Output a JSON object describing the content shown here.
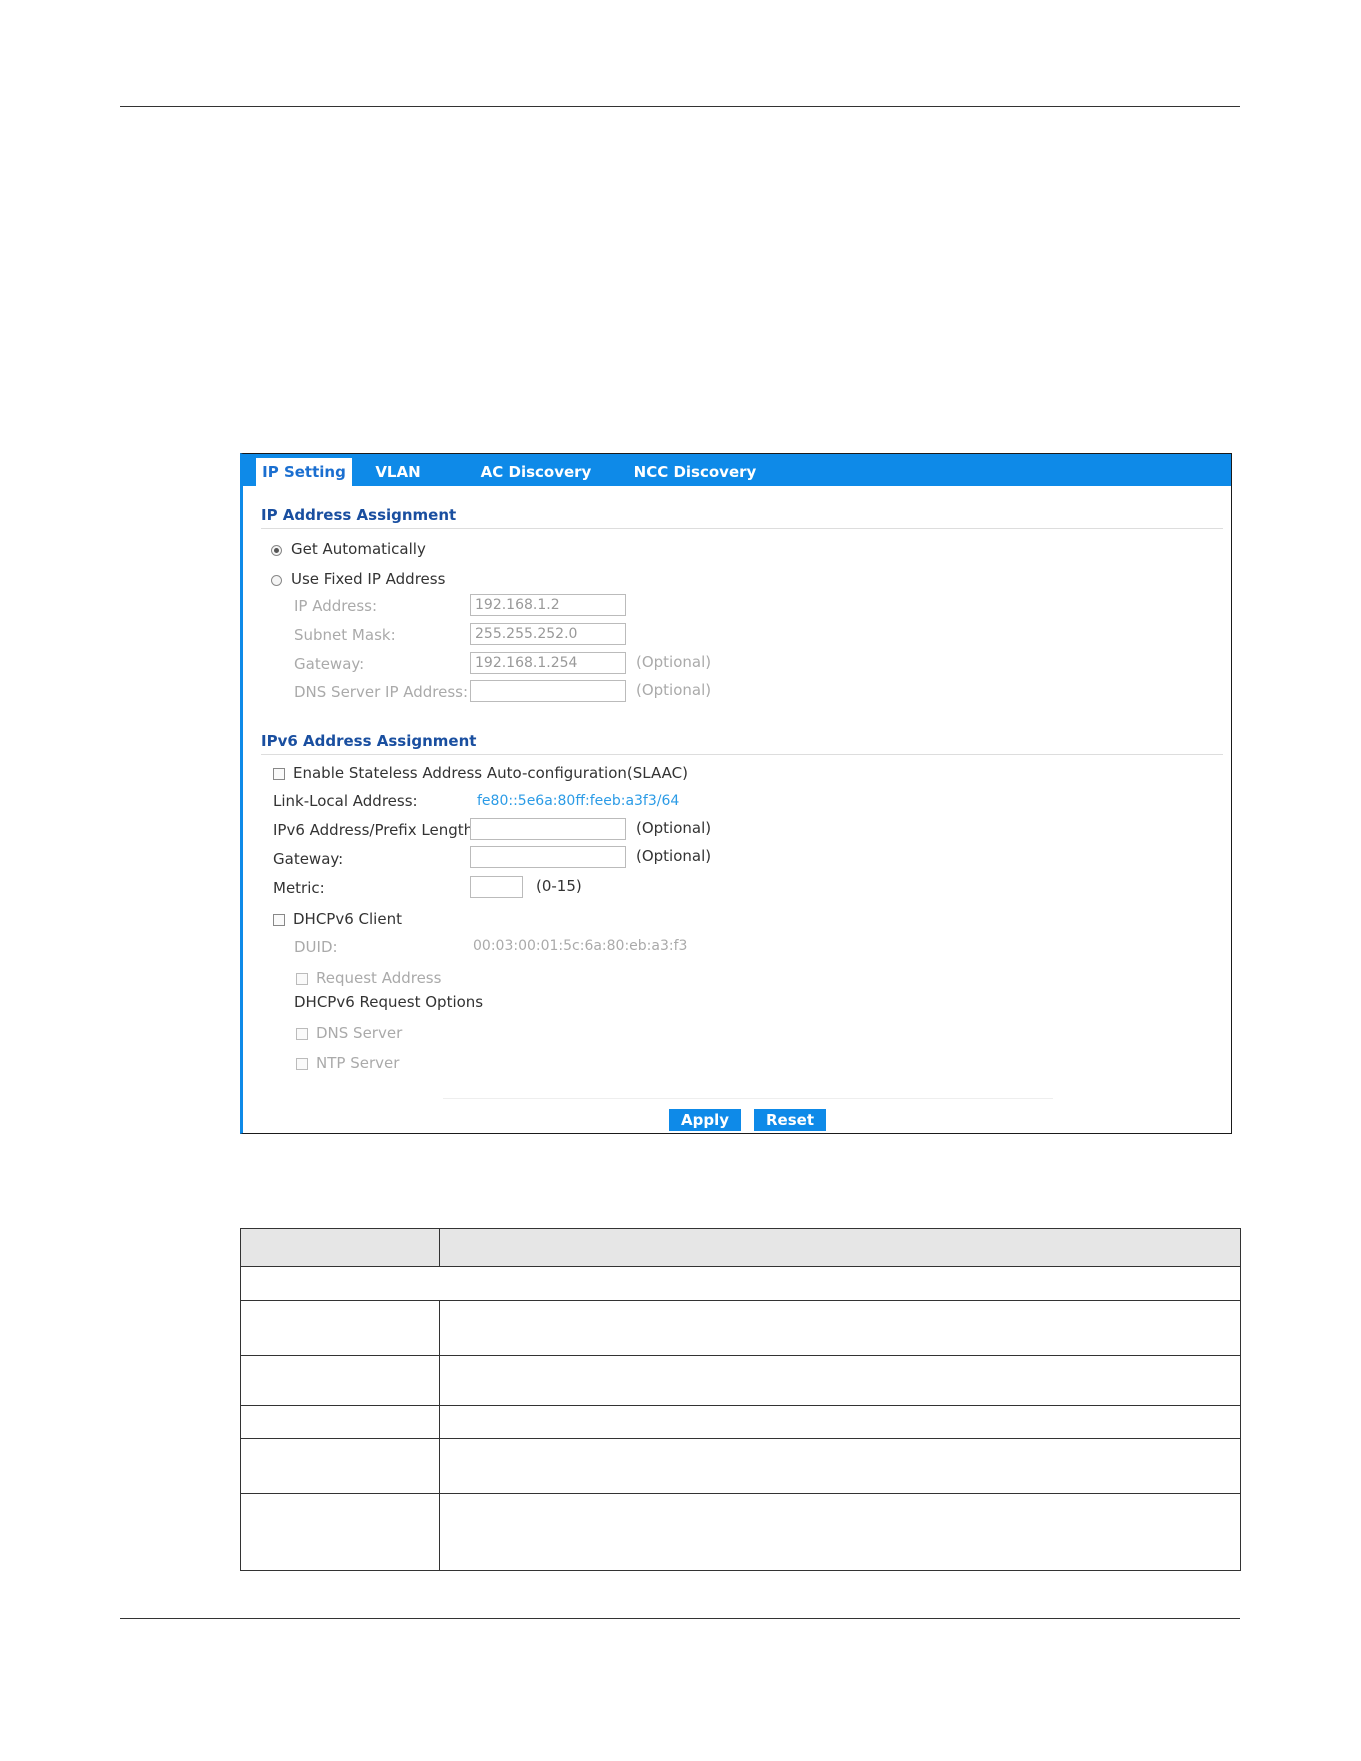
{
  "tabs": [
    {
      "label": "IP Setting",
      "active": true
    },
    {
      "label": "VLAN",
      "active": false
    },
    {
      "label": "AC Discovery",
      "active": false
    },
    {
      "label": "NCC Discovery",
      "active": false
    }
  ],
  "ipv4": {
    "title": "IP Address Assignment",
    "get_auto_label": "Get Automatically",
    "get_auto_selected": true,
    "fixed_label": "Use Fixed IP Address",
    "fixed_selected": false,
    "ip_label": "IP Address:",
    "ip_value": "192.168.1.2",
    "mask_label": "Subnet Mask:",
    "mask_value": "255.255.252.0",
    "gateway_label": "Gateway:",
    "gateway_value": "192.168.1.254",
    "gateway_hint": "(Optional)",
    "dns_label": "DNS Server IP Address:",
    "dns_value": "",
    "dns_hint": "(Optional)"
  },
  "ipv6": {
    "title": "IPv6 Address Assignment",
    "slaac_label": "Enable Stateless Address Auto-configuration(SLAAC)",
    "slaac_checked": false,
    "link_local_label": "Link-Local Address:",
    "link_local_value": "fe80::5e6a:80ff:feeb:a3f3/64",
    "prefix_label": "IPv6 Address/Prefix Length:",
    "prefix_value": "",
    "prefix_hint": "(Optional)",
    "gateway_label": "Gateway:",
    "gateway_value": "",
    "gateway_hint": "(Optional)",
    "metric_label": "Metric:",
    "metric_value": "",
    "metric_hint": "(0-15)",
    "dhcp_label": "DHCPv6 Client",
    "dhcp_checked": false,
    "duid_label": "DUID:",
    "duid_value": "00:03:00:01:5c:6a:80:eb:a3:f3",
    "request_address_label": "Request Address",
    "request_options_label": "DHCPv6 Request Options",
    "dns_server_label": "DNS Server",
    "ntp_server_label": "NTP Server"
  },
  "buttons": {
    "apply": "Apply",
    "reset": "Reset"
  }
}
